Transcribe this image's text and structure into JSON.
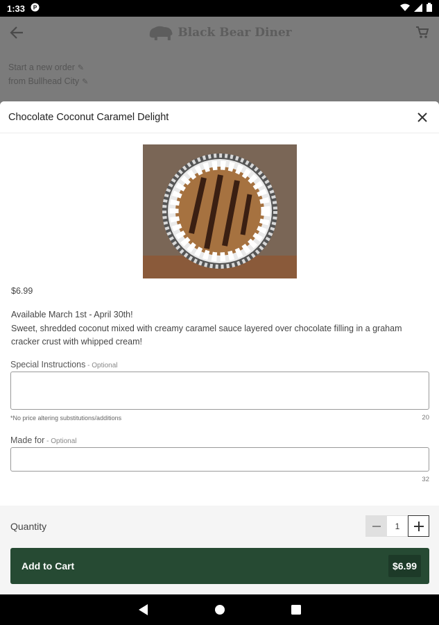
{
  "status_bar": {
    "time": "1:33"
  },
  "background": {
    "brand_name": "Black Bear Diner",
    "order_line1": "Start a new order",
    "order_line2": "from Bullhead City"
  },
  "modal": {
    "title": "Chocolate Coconut Caramel Delight",
    "price": "$6.99",
    "description_line1": "Available March 1st - April 30th!",
    "description_line2": "Sweet, shredded coconut mixed with creamy caramel sauce layered over chocolate filling in a graham cracker crust with whipped cream!",
    "special_instructions": {
      "label": "Special Instructions",
      "optional": " - Optional",
      "value": "",
      "hint": "*No price altering substitutions/additions",
      "counter": "20"
    },
    "made_for": {
      "label": "Made for",
      "optional": " - Optional",
      "value": "",
      "counter": "32"
    },
    "quantity": {
      "label": "Quantity",
      "value": "1"
    },
    "add_to_cart": {
      "label": "Add to Cart",
      "price": "$6.99"
    }
  },
  "icons": {
    "back": "arrow-left-icon",
    "cart": "cart-icon",
    "close": "close-icon",
    "nav_back": "triangle-back-icon",
    "nav_home": "circle-home-icon",
    "nav_recents": "square-recents-icon"
  },
  "colors": {
    "cta_green": "#264a33",
    "overlay_gray": "#7b7b7b"
  }
}
